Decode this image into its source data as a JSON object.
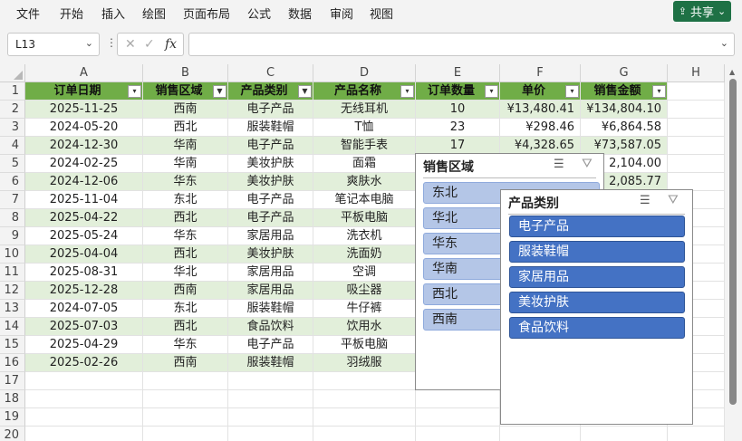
{
  "menu": [
    "文件",
    "开始",
    "插入",
    "绘图",
    "页面布局",
    "公式",
    "数据",
    "审阅",
    "视图"
  ],
  "share_label": "共享",
  "name_box": "L13",
  "formula_value": "",
  "columns": [
    "A",
    "B",
    "C",
    "D",
    "E",
    "F",
    "G",
    "H"
  ],
  "row_numbers": [
    "1",
    "2",
    "3",
    "4",
    "5",
    "6",
    "7",
    "8",
    "9",
    "10",
    "11",
    "12",
    "13",
    "14",
    "15",
    "16",
    "17",
    "18",
    "19",
    "20"
  ],
  "table": {
    "headers": [
      "订单日期",
      "销售区域",
      "产品类别",
      "产品名称",
      "订单数量",
      "单价",
      "销售金额"
    ],
    "rows": [
      [
        "2025-11-25",
        "西南",
        "电子产品",
        "无线耳机",
        "10",
        "¥13,480.41",
        "¥134,804.10"
      ],
      [
        "2024-05-20",
        "西北",
        "服装鞋帽",
        "T恤",
        "23",
        "¥298.46",
        "¥6,864.58"
      ],
      [
        "2024-12-30",
        "华南",
        "电子产品",
        "智能手表",
        "17",
        "¥4,328.65",
        "¥73,587.05"
      ],
      [
        "2024-02-25",
        "华南",
        "美妆护肤",
        "面霜",
        "",
        "",
        "2,104.00"
      ],
      [
        "2024-12-06",
        "华东",
        "美妆护肤",
        "爽肤水",
        "",
        "",
        "2,085.77"
      ],
      [
        "2025-11-04",
        "东北",
        "电子产品",
        "笔记本电脑",
        "",
        "",
        ""
      ],
      [
        "2025-04-22",
        "西北",
        "电子产品",
        "平板电脑",
        "",
        "",
        ""
      ],
      [
        "2025-05-24",
        "华东",
        "家居用品",
        "洗衣机",
        "",
        "",
        ""
      ],
      [
        "2025-04-04",
        "西北",
        "美妆护肤",
        "洗面奶",
        "",
        "",
        ""
      ],
      [
        "2025-08-31",
        "华北",
        "家居用品",
        "空调",
        "",
        "",
        ""
      ],
      [
        "2025-12-28",
        "西南",
        "家居用品",
        "吸尘器",
        "",
        "",
        ""
      ],
      [
        "2024-07-05",
        "东北",
        "服装鞋帽",
        "牛仔裤",
        "",
        "",
        ""
      ],
      [
        "2025-07-03",
        "西北",
        "食品饮料",
        "饮用水",
        "",
        "",
        ""
      ],
      [
        "2025-04-29",
        "华东",
        "电子产品",
        "平板电脑",
        "",
        "",
        ""
      ],
      [
        "2025-02-26",
        "西南",
        "服装鞋帽",
        "羽绒服",
        "",
        "",
        ""
      ]
    ]
  },
  "slicer_region": {
    "title": "销售区域",
    "items": [
      "东北",
      "华北",
      "华东",
      "华南",
      "西北",
      "西南"
    ]
  },
  "slicer_category": {
    "title": "产品类别",
    "items": [
      "电子产品",
      "服装鞋帽",
      "家居用品",
      "美妆护肤",
      "食品饮料"
    ]
  },
  "colors": {
    "header_green": "#70ad47",
    "band_green": "#e2efda",
    "slicer_light": "#b4c6e7",
    "slicer_dark": "#4472c4",
    "share_green": "#1e7145"
  }
}
